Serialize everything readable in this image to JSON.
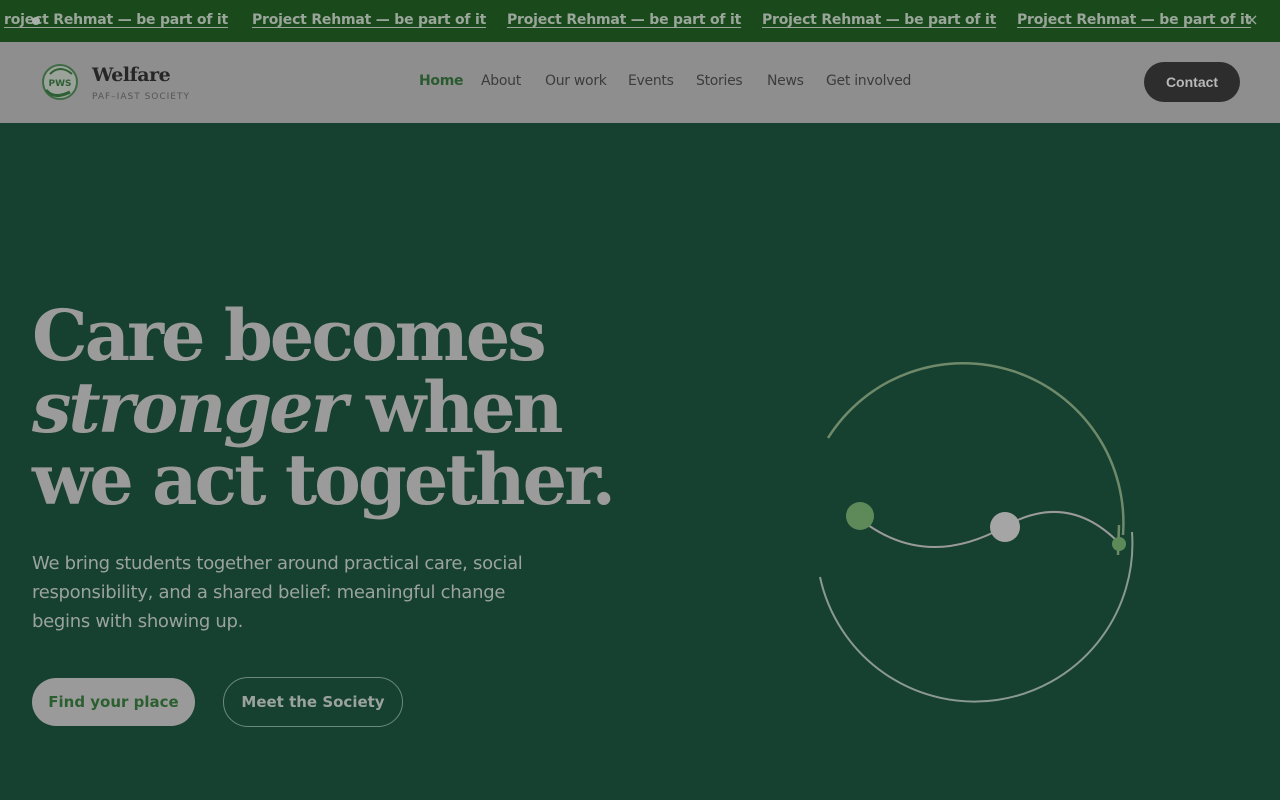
{
  "ticker": {
    "items": [
      "roject Rehmat — be part of it",
      "Project Rehmat — be part of it",
      "Project Rehmat — be part of it",
      "Project Rehmat — be part of it",
      "Project Rehmat — be part of it"
    ],
    "close_glyph": "×"
  },
  "brand": {
    "logo_text": "PWS",
    "name": "Welfare",
    "subtitle": "PAF–IAST SOCIETY"
  },
  "nav": {
    "items": [
      "Home",
      "About",
      "Our work",
      "Events",
      "Stories",
      "News",
      "Get involved"
    ],
    "active": "Home"
  },
  "header": {
    "contact_label": "Contact"
  },
  "hero": {
    "title_line1": "Care becomes",
    "title_emph": "stronger",
    "title_line2_rest": " when",
    "title_line3": "we act together.",
    "description": "We bring students together around practical care, social responsibility, and a shared belief: meaningful change begins with showing up.",
    "primary_cta": "Find your place",
    "secondary_cta": "Meet the Society"
  },
  "colors": {
    "ticker_bg": "#1a4a1c",
    "header_bg": "#8e8e8e",
    "hero_bg": "#16402f",
    "accent_green": "#2a5a2f"
  }
}
